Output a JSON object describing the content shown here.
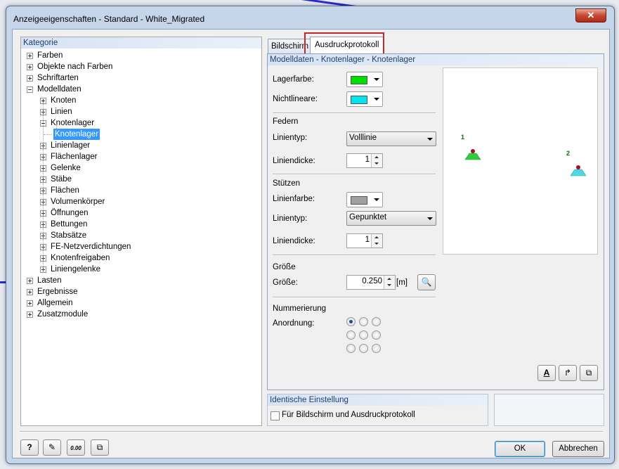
{
  "window": {
    "title": "Anzeigeeigenschaften - Standard - White_Migrated",
    "close_label": "✕"
  },
  "kategorie": {
    "header": "Kategorie",
    "items": [
      {
        "label": "Farben",
        "level": 0,
        "expander": "plus"
      },
      {
        "label": "Objekte nach Farben",
        "level": 0,
        "expander": "plus"
      },
      {
        "label": "Schriftarten",
        "level": 0,
        "expander": "plus"
      },
      {
        "label": "Modelldaten",
        "level": 0,
        "expander": "minus"
      },
      {
        "label": "Knoten",
        "level": 1,
        "expander": "plus"
      },
      {
        "label": "Linien",
        "level": 1,
        "expander": "plus"
      },
      {
        "label": "Knotenlager",
        "level": 1,
        "expander": "minus"
      },
      {
        "label": "Knotenlager",
        "level": 2,
        "expander": "none",
        "selected": true
      },
      {
        "label": "Linienlager",
        "level": 1,
        "expander": "plus"
      },
      {
        "label": "Flächenlager",
        "level": 1,
        "expander": "plus"
      },
      {
        "label": "Gelenke",
        "level": 1,
        "expander": "plus"
      },
      {
        "label": "Stäbe",
        "level": 1,
        "expander": "plus"
      },
      {
        "label": "Flächen",
        "level": 1,
        "expander": "plus"
      },
      {
        "label": "Volumenkörper",
        "level": 1,
        "expander": "plus"
      },
      {
        "label": "Öffnungen",
        "level": 1,
        "expander": "plus"
      },
      {
        "label": "Bettungen",
        "level": 1,
        "expander": "plus"
      },
      {
        "label": "Stabsätze",
        "level": 1,
        "expander": "plus"
      },
      {
        "label": "FE-Netzverdichtungen",
        "level": 1,
        "expander": "plus"
      },
      {
        "label": "Knotenfreigaben",
        "level": 1,
        "expander": "plus"
      },
      {
        "label": "Liniengelenke",
        "level": 1,
        "expander": "plus"
      },
      {
        "label": "Lasten",
        "level": 0,
        "expander": "plus"
      },
      {
        "label": "Ergebnisse",
        "level": 0,
        "expander": "plus"
      },
      {
        "label": "Allgemein",
        "level": 0,
        "expander": "plus"
      },
      {
        "label": "Zusatzmodule",
        "level": 0,
        "expander": "plus"
      }
    ]
  },
  "tabs": [
    {
      "label": "Bildschirm",
      "active": false
    },
    {
      "label": "Ausdruckprotokoll",
      "active": true
    }
  ],
  "section": {
    "header": "Modelldaten - Knotenlager - Knotenlager",
    "lagerfarbe": {
      "label": "Lagerfarbe:",
      "color": "#00e000"
    },
    "nichtlineare": {
      "label": "Nichtlineare:",
      "color": "#00e5ee"
    },
    "federn": {
      "title": "Federn",
      "linientyp_label": "Linientyp:",
      "linientyp_value": "Volllinie",
      "liniendicke_label": "Liniendicke:",
      "liniendicke_value": "1"
    },
    "stuetzen": {
      "title": "Stützen",
      "linienfarbe_label": "Linienfarbe:",
      "linienfarbe_color": "#a0a0a0",
      "linientyp_label": "Linientyp:",
      "linientyp_value": "Gepunktet",
      "liniendicke_label": "Liniendicke:",
      "liniendicke_value": "1"
    },
    "groesse": {
      "title": "Größe",
      "label": "Größe:",
      "value": "0.250",
      "unit": "[m]"
    },
    "nummerierung": {
      "title": "Nummerierung",
      "anordnung_label": "Anordnung:",
      "selected_index": 0
    },
    "preview": {
      "node1_label": "1",
      "node2_label": "2",
      "node1_color": "#22cc44",
      "node2_color": "#22d4dd"
    }
  },
  "identische": {
    "header": "Identische Einstellung",
    "checkbox_label": "Für Bildschirm und Ausdruckprotokoll",
    "checked": false
  },
  "buttons": {
    "ok": "OK",
    "cancel": "Abbrechen"
  },
  "footer_icons": [
    "help-icon",
    "edit-icon",
    "units-icon",
    "copy-icon"
  ],
  "footer_units_text": "0.00"
}
